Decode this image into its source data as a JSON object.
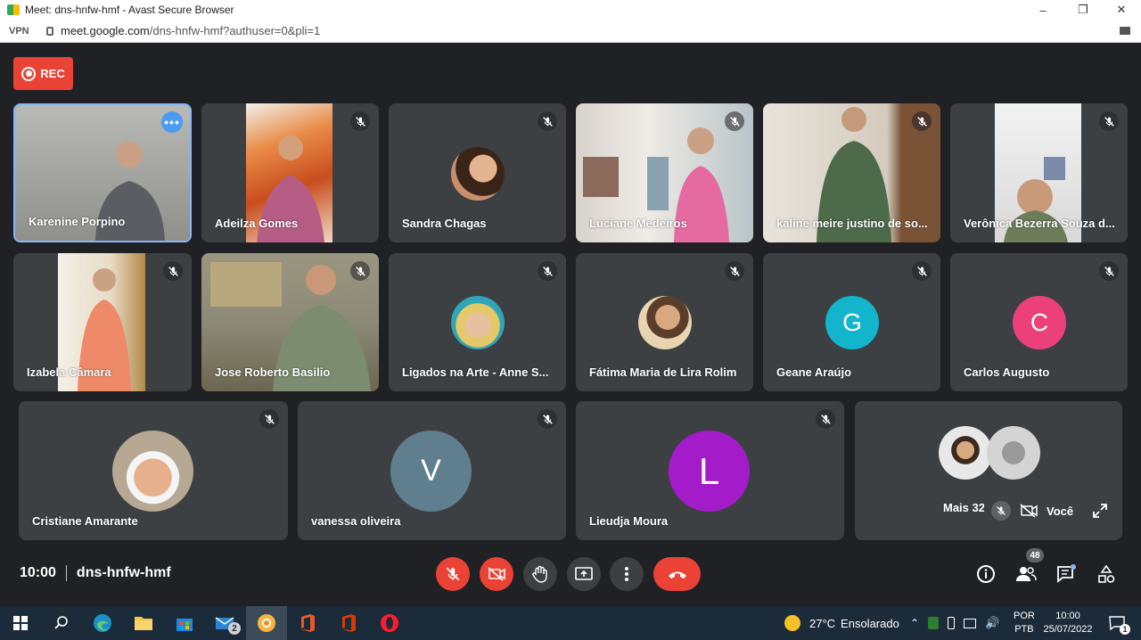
{
  "window": {
    "title": "Meet: dns-hnfw-hmf - Avast Secure Browser",
    "controls": {
      "minimize": "–",
      "restore": "❐",
      "close": "✕"
    }
  },
  "urlbar": {
    "vpn_label": "VPN",
    "url_host": "meet.google.com",
    "url_path": "/dns-hnfw-hmf?authuser=0&pli=1"
  },
  "rec": {
    "label": "REC"
  },
  "participants": [
    {
      "name": "Karenine Porpino",
      "kind": "video",
      "bg": "#a8aaa6"
    },
    {
      "name": "Adeilza Gomes",
      "kind": "video",
      "bg": "#d9773f"
    },
    {
      "name": "Sandra Chagas",
      "kind": "photo",
      "bg": "#8b5a3c"
    },
    {
      "name": "Luciane Medeiros",
      "kind": "video",
      "bg": "#c9c4be"
    },
    {
      "name": "kaline meire justino de so...",
      "kind": "video",
      "bg": "#bfb8a8"
    },
    {
      "name": "Verônica Bezerra Souza d...",
      "kind": "video",
      "bg": "#d8d8d8"
    },
    {
      "name": "Izabela Câmara",
      "kind": "video",
      "bg": "#c9a66b"
    },
    {
      "name": "Jose Roberto Basilio",
      "kind": "video",
      "bg": "#8e8a74"
    },
    {
      "name": "Ligados na Arte - Anne S...",
      "kind": "photo",
      "bg": "#3aa5b5"
    },
    {
      "name": "Fátima Maria de Lira Rolim",
      "kind": "photo",
      "bg": "#a88a6a"
    },
    {
      "name": "Geane Araújo",
      "kind": "letter",
      "letter": "G",
      "color": "#12b5cb"
    },
    {
      "name": "Carlos Augusto",
      "kind": "letter",
      "letter": "C",
      "color": "#ec407a"
    },
    {
      "name": "Cristiane Amarante",
      "kind": "photo",
      "bg": "#d8c4a8"
    },
    {
      "name": "vanessa oliveira",
      "kind": "letter",
      "letter": "V",
      "color": "#5f7f8f"
    },
    {
      "name": "Lieudja Moura",
      "kind": "letter",
      "letter": "L",
      "color": "#a41cc9"
    }
  ],
  "overflow_tile": {
    "label": "Mais 32"
  },
  "self_view": {
    "label": "Você"
  },
  "bottom_bar": {
    "time": "10:00",
    "meeting_code": "dns-hnfw-hmf",
    "people_count": "48"
  },
  "taskbar": {
    "mail_badge": "2",
    "weather_temp": "27°C",
    "weather_text": "Ensolarado",
    "lang_top": "POR",
    "lang_bottom": "PTB",
    "clock_time": "10:00",
    "clock_date": "25/07/2022",
    "notif_count": "1"
  },
  "colors": {
    "accent_red": "#ea4335",
    "tile_bg": "#3c4043",
    "page_bg": "#202124",
    "highlight_blue": "#8ab4f8"
  }
}
